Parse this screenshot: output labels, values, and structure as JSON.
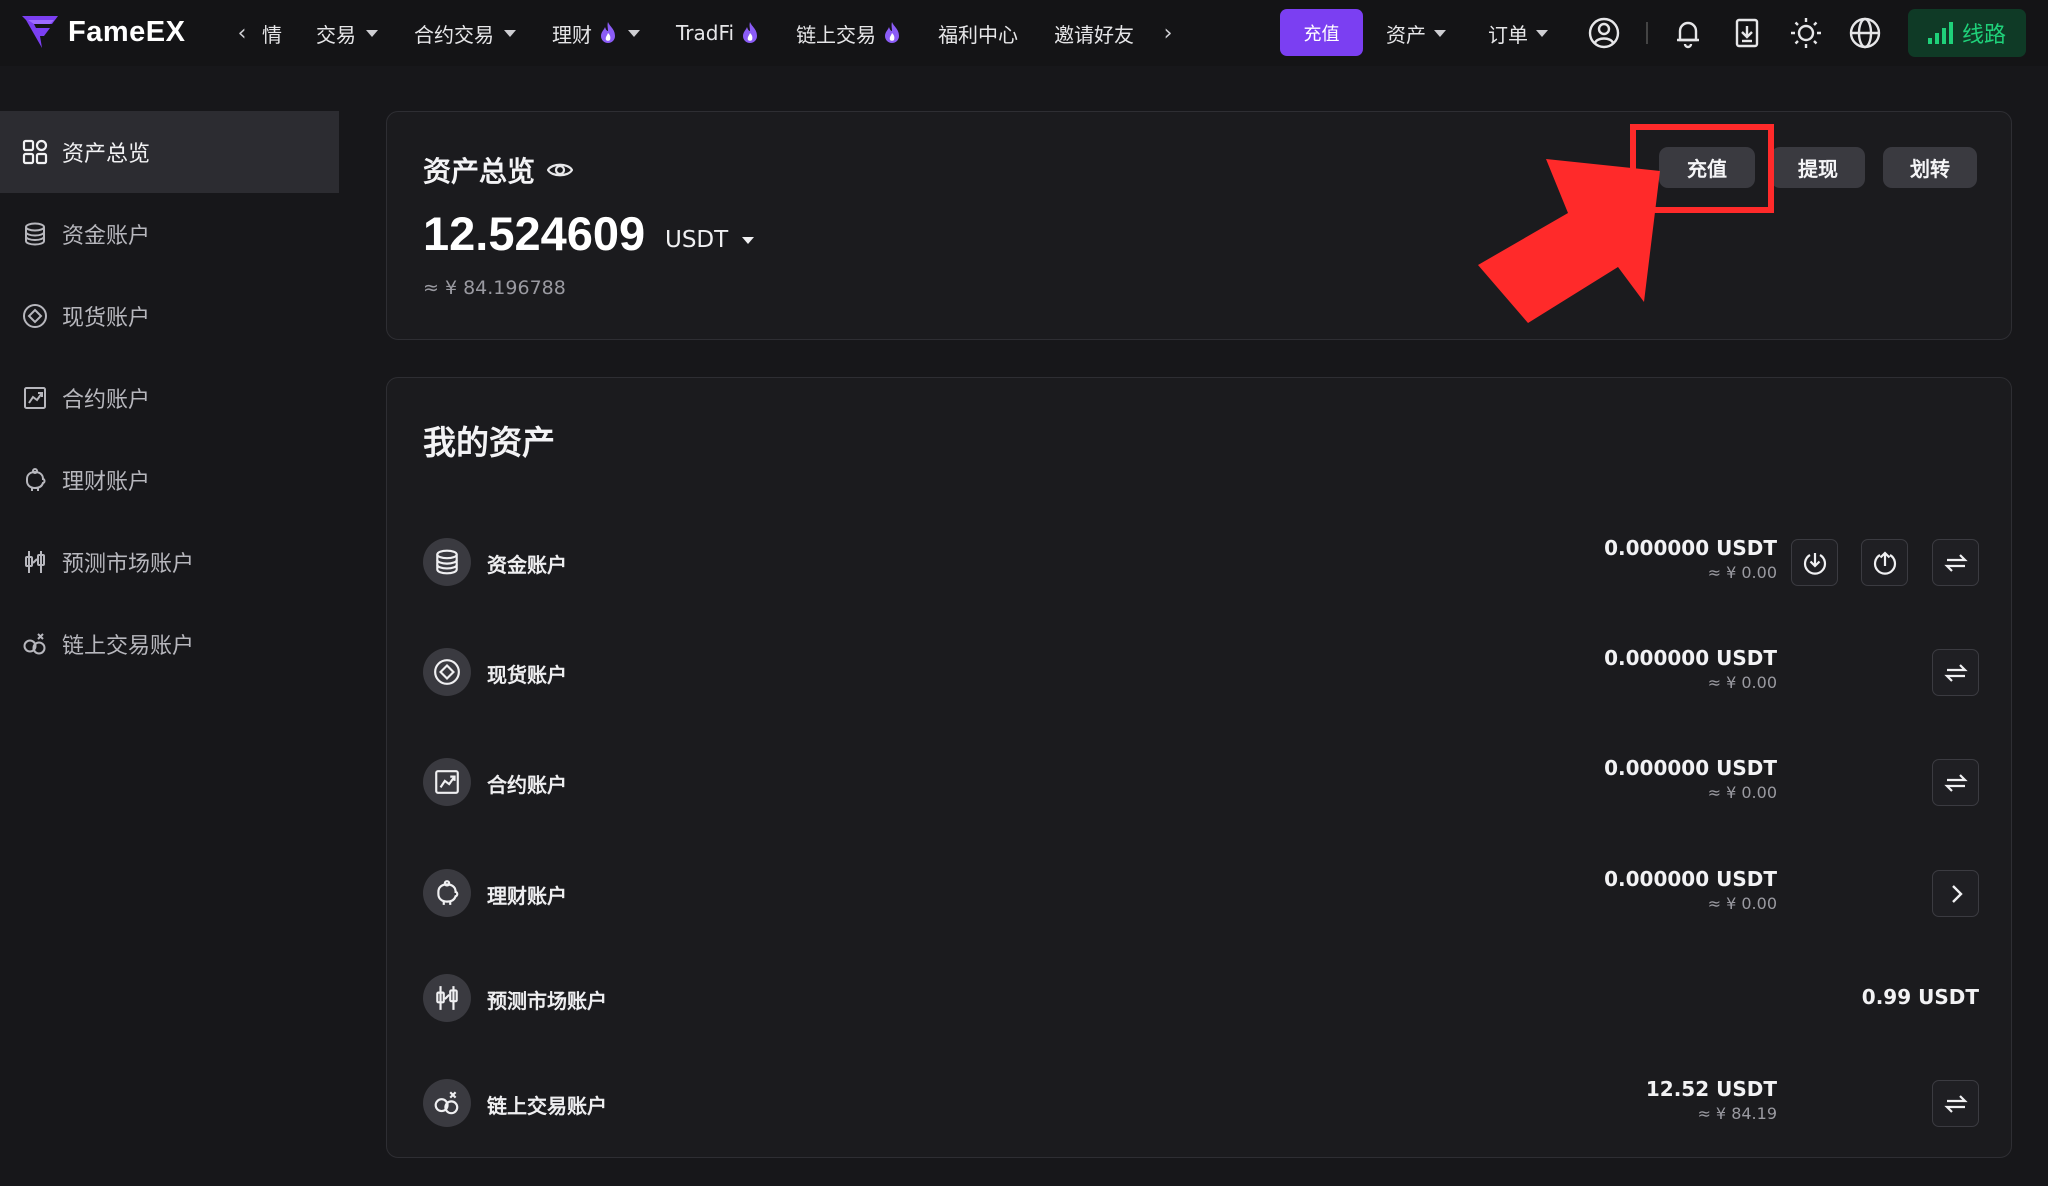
{
  "brand": {
    "name": "FameEX"
  },
  "nav": {
    "partial_item": "情",
    "items": [
      {
        "label": "交易",
        "dropdown": true,
        "hot": false
      },
      {
        "label": "合约交易",
        "dropdown": true,
        "hot": false
      },
      {
        "label": "理财",
        "dropdown": true,
        "hot": true
      },
      {
        "label": "TradFi",
        "dropdown": false,
        "hot": true
      },
      {
        "label": "链上交易",
        "dropdown": false,
        "hot": true
      },
      {
        "label": "福利中心",
        "dropdown": false,
        "hot": false
      },
      {
        "label": "邀请好友",
        "dropdown": false,
        "hot": false
      }
    ],
    "deposit_label": "充值",
    "assets_label": "资产",
    "orders_label": "订单",
    "route_label": "线路",
    "icons": [
      "user-icon",
      "bell-icon",
      "download-icon",
      "theme-sun-icon",
      "globe-icon",
      "signal-icon"
    ]
  },
  "sidebar": {
    "items": [
      {
        "label": "资产总览",
        "icon": "grid-icon",
        "active": true
      },
      {
        "label": "资金账户",
        "icon": "coins-icon",
        "active": false
      },
      {
        "label": "现货账户",
        "icon": "spot-icon",
        "active": false
      },
      {
        "label": "合约账户",
        "icon": "chart-icon",
        "active": false
      },
      {
        "label": "理财账户",
        "icon": "piggy-icon",
        "active": false
      },
      {
        "label": "预测市场账户",
        "icon": "candlestick-icon",
        "active": false
      },
      {
        "label": "链上交易账户",
        "icon": "chain-icon",
        "active": false
      }
    ]
  },
  "overview": {
    "title": "资产总览",
    "amount": "12.524609",
    "unit": "USDT",
    "cny": "≈ ¥ 84.196788",
    "buttons": {
      "deposit": "充值",
      "withdraw": "提现",
      "transfer": "划转"
    },
    "annotation_color": "#ff2a2a"
  },
  "assets": {
    "title": "我的资产",
    "rows": [
      {
        "name": "资金账户",
        "icon": "coins-icon",
        "value": "0.000000 USDT",
        "sub": "≈ ¥ 0.00",
        "actions": [
          "deposit-icon",
          "withdraw-icon",
          "transfer-icon"
        ]
      },
      {
        "name": "现货账户",
        "icon": "spot-icon",
        "value": "0.000000 USDT",
        "sub": "≈ ¥ 0.00",
        "actions": [
          "transfer-icon"
        ]
      },
      {
        "name": "合约账户",
        "icon": "chart-icon",
        "value": "0.000000 USDT",
        "sub": "≈ ¥ 0.00",
        "actions": [
          "transfer-icon"
        ]
      },
      {
        "name": "理财账户",
        "icon": "piggy-icon",
        "value": "0.000000 USDT",
        "sub": "≈ ¥ 0.00",
        "actions": [
          "chevron-right-icon"
        ]
      },
      {
        "name": "预测市场账户",
        "icon": "candlestick-icon",
        "value": "0.99 USDT",
        "sub": "",
        "actions": []
      },
      {
        "name": "链上交易账户",
        "icon": "chain-icon",
        "value": "12.52 USDT",
        "sub": "≈ ¥ 84.19",
        "actions": [
          "transfer-icon"
        ]
      }
    ]
  },
  "colors": {
    "accent": "#7b3ff2",
    "route_bg": "#0f3a26",
    "route_text": "#1fd17a"
  }
}
